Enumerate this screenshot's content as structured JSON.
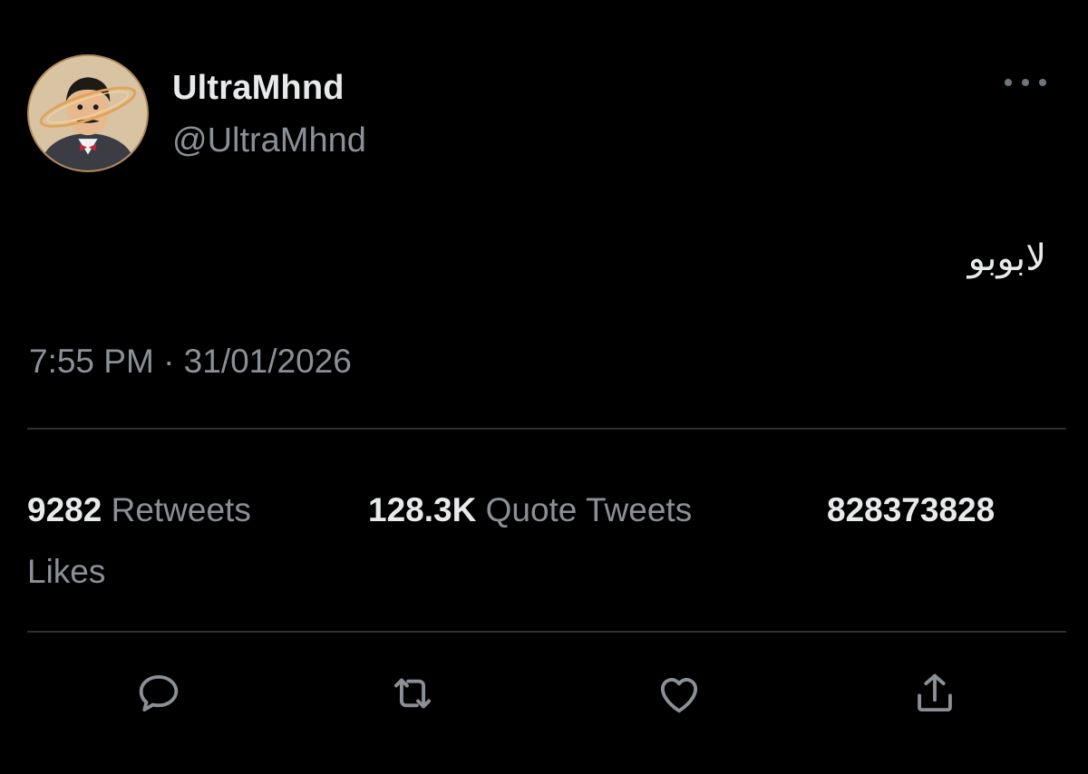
{
  "colors": {
    "background": "#000000",
    "primary_text": "#e7e9ea",
    "secondary_text": "#8b9096",
    "divider": "#2b2f33",
    "icon": "#6e767d"
  },
  "author": {
    "display_name": "UltraMhnd",
    "handle": "@UltraMhnd",
    "avatar_icon": "avatar-cartoon-man-icon"
  },
  "tweet": {
    "text": "لابوبو",
    "timestamp": "7:55 PM · 31/01/2026"
  },
  "stats": {
    "retweets_count": "9282",
    "retweets_label": "Retweets",
    "quotes_count": "128.3K",
    "quotes_label": "Quote Tweets",
    "likes_count": "828373828",
    "likes_label": "Likes"
  },
  "actions": [
    {
      "name": "reply",
      "icon": "speech-bubble-icon"
    },
    {
      "name": "retweet",
      "icon": "retweet-arrows-icon"
    },
    {
      "name": "like",
      "icon": "heart-icon"
    },
    {
      "name": "share",
      "icon": "upload-share-icon"
    }
  ],
  "menu_icon": "more-dots-icon"
}
